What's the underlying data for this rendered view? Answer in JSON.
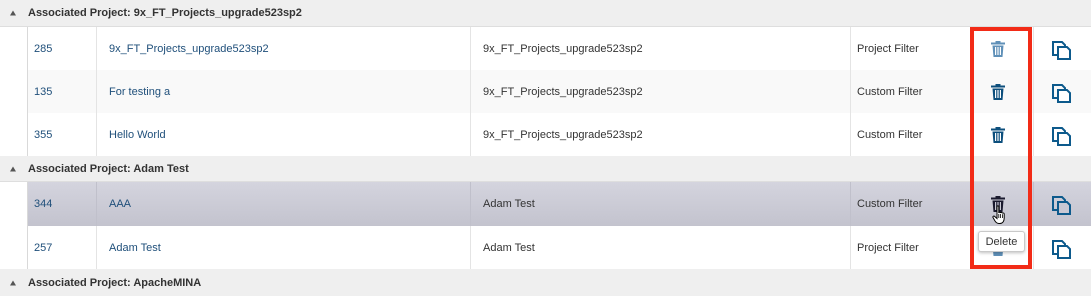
{
  "groups": [
    {
      "title": "Associated Project: 9x_FT_Projects_upgrade523sp2",
      "rows": [
        {
          "id": "285",
          "name": "9x_FT_Projects_upgrade523sp2",
          "project": "9x_FT_Projects_upgrade523sp2",
          "type": "Project Filter"
        },
        {
          "id": "135",
          "name": "For testing a",
          "project": "9x_FT_Projects_upgrade523sp2",
          "type": "Custom Filter"
        },
        {
          "id": "355",
          "name": "Hello World",
          "project": "9x_FT_Projects_upgrade523sp2",
          "type": "Custom Filter"
        }
      ]
    },
    {
      "title": "Associated Project: Adam Test",
      "rows": [
        {
          "id": "344",
          "name": "AAA",
          "project": "Adam Test",
          "type": "Custom Filter"
        },
        {
          "id": "257",
          "name": "Adam Test",
          "project": "Adam Test",
          "type": "Project Filter"
        }
      ]
    },
    {
      "title": "Associated Project: ApacheMINA",
      "rows": []
    }
  ],
  "tooltip": "Delete",
  "icons": {
    "delete": "trash-icon",
    "copy": "copy-icon",
    "expand": "collapse-triangle-icon"
  },
  "colors": {
    "icon_blue": "#0d5a8c",
    "highlight": "#f22b17",
    "selected_row": "#c9c9d4"
  }
}
